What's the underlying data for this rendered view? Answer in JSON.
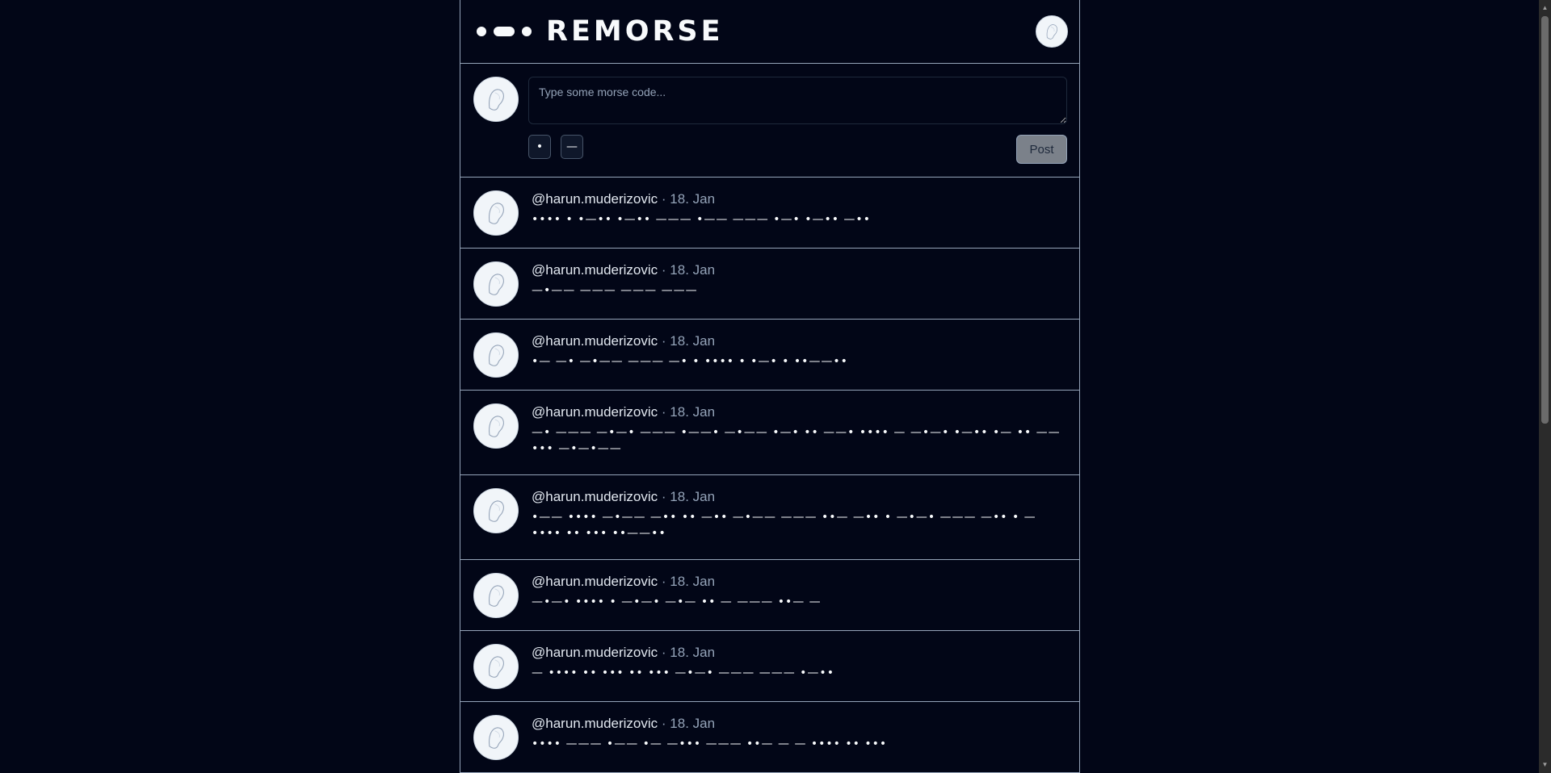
{
  "app": {
    "brand": "REMORSE"
  },
  "composer": {
    "placeholder": "Type some morse code...",
    "dot_label": "•",
    "dash_label": "—",
    "post_label": "Post"
  },
  "feed": {
    "posts": [
      {
        "user": "@harun.muderizovic",
        "date": "18. Jan",
        "body": "•••• • •—•• •—•• ——— •—— ——— •—• •—•• —••"
      },
      {
        "user": "@harun.muderizovic",
        "date": "18. Jan",
        "body": "—•—— ——— ——— ———"
      },
      {
        "user": "@harun.muderizovic",
        "date": "18. Jan",
        "body": "•— —• —•—— ——— —• • •••• • •—• • ••——••"
      },
      {
        "user": "@harun.muderizovic",
        "date": "18. Jan",
        "body": "—• ——— —•—• ——— •——• —•—— •—• •• ——• •••• — —•—• •—•• •— •• —— ••• —•—•——"
      },
      {
        "user": "@harun.muderizovic",
        "date": "18. Jan",
        "body": "•—— •••• —•—— —•• •• —•• —•—— ——— ••— —•• • —•—• ——— —•• • — •••• •• ••• ••——••"
      },
      {
        "user": "@harun.muderizovic",
        "date": "18. Jan",
        "body": "—•—• •••• • —•—• —•— •• — ——— ••— —"
      },
      {
        "user": "@harun.muderizovic",
        "date": "18. Jan",
        "body": "— •••• •• ••• •• ••• —•—• ——— ——— •—••"
      },
      {
        "user": "@harun.muderizovic",
        "date": "18. Jan",
        "body": "•••• ——— •—— •— —••• ——— ••— — — •••• •• •••"
      }
    ]
  }
}
